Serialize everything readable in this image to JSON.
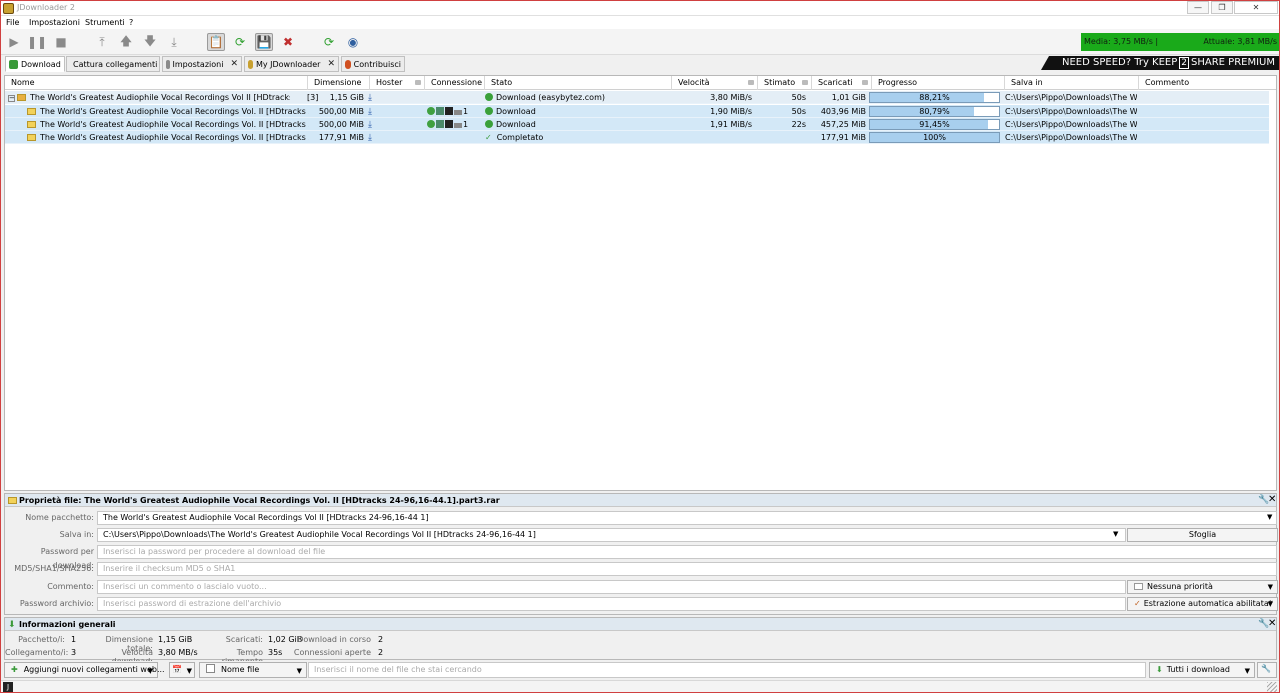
{
  "window": {
    "title": "JDownloader 2",
    "controls": [
      "—",
      "❐",
      "✕"
    ]
  },
  "menu": [
    "File",
    "Impostazioni",
    "Strumenti",
    "?"
  ],
  "speed": {
    "average": "Media: 3,75 MB/s |",
    "current": "Attuale: 3,81 MB/s",
    "color": "#1aaa1a"
  },
  "tabs": [
    {
      "label": "Download",
      "icon": "download-icon",
      "closable": false
    },
    {
      "label": "Cattura collegamenti",
      "icon": "link-grabber-icon",
      "closable": false
    },
    {
      "label": "Impostazioni",
      "icon": "settings-icon",
      "closable": true
    },
    {
      "label": "My JDownloader",
      "icon": "my-jdownloader-icon",
      "closable": true
    },
    {
      "label": "Contribuisci",
      "icon": "heart-icon",
      "closable": false
    }
  ],
  "banner": {
    "pre": "NEED SPEED? Try KEEP",
    "mid": "2",
    "post": "SHARE PREMIUM"
  },
  "columns": [
    "Nome",
    "Dimensione",
    "Hoster",
    "Connessione",
    "Stato",
    "Velocità",
    "Stimato",
    "Scaricati",
    "Progresso",
    "Salva in",
    "Commento"
  ],
  "package": {
    "name": "The World's Greatest Audiophile Vocal Recordings Vol II [HDtracks 24-96...",
    "count": "[3]",
    "size": "1,15 GiB",
    "status": "Download (easybytez.com)",
    "speed": "3,80 MiB/s",
    "eta": "50s",
    "loaded": "1,01 GiB",
    "progress": 88.21,
    "progress_text": "88,21%",
    "path": "C:\\Users\\Pippo\\Downloads\\The Wo..."
  },
  "files": [
    {
      "name": "The World's Greatest Audiophile Vocal Recordings Vol. II [HDtracks 24-96,16...",
      "size": "500,00 MiB",
      "conn": "1",
      "status": "Download",
      "speed": "1,90 MiB/s",
      "eta": "50s",
      "loaded": "403,96 MiB",
      "progress": 80.79,
      "progress_text": "80,79%",
      "path": "C:\\Users\\Pippo\\Downloads\\The Wo..."
    },
    {
      "name": "The World's Greatest Audiophile Vocal Recordings Vol. II [HDtracks 24-96,16...",
      "size": "500,00 MiB",
      "conn": "1",
      "status": "Download",
      "speed": "1,91 MiB/s",
      "eta": "22s",
      "loaded": "457,25 MiB",
      "progress": 91.45,
      "progress_text": "91,45%",
      "path": "C:\\Users\\Pippo\\Downloads\\The Wo..."
    },
    {
      "name": "The World's Greatest Audiophile Vocal Recordings Vol. II [HDtracks 24-96,16...",
      "size": "177,91 MiB",
      "conn": "",
      "status": "Completato",
      "speed": "",
      "eta": "",
      "loaded": "177,91 MiB",
      "progress": 100,
      "progress_text": "100%",
      "path": "C:\\Users\\Pippo\\Downloads\\The Wo..."
    }
  ],
  "props": {
    "title": "Proprietà file: The World's Greatest Audiophile Vocal Recordings Vol. II [HDtracks 24-96,16-44.1].part3.rar",
    "package_label": "Nome pacchetto:",
    "package_value": "The World's Greatest Audiophile Vocal Recordings Vol II [HDtracks 24-96,16-44 1]",
    "save_label": "Salva in:",
    "save_value": "C:\\Users\\Pippo\\Downloads\\The World's Greatest Audiophile Vocal Recordings Vol II [HDtracks 24-96,16-44 1]",
    "browse": "Sfoglia",
    "pwd_label": "Password per download:",
    "pwd_ph": "Inserisci la password per procedere al download del file",
    "hash_label": "MD5/SHA1/SHA256:",
    "hash_ph": "Inserire il checksum MD5 o SHA1",
    "comment_label": "Commento:",
    "comment_ph": "Inserisci un commento o lascialo vuoto...",
    "priority": "Nessuna priorità",
    "archive_label": "Password archivio:",
    "archive_ph": "Inserisci password di estrazione dell'archivio",
    "extract": "Estrazione automatica abilitata*"
  },
  "info": {
    "title": "Informazioni generali",
    "packages_label": "Pacchetto/i:",
    "packages": "1",
    "total_label": "Dimensione totale:",
    "total": "1,15 GiB",
    "loaded_label": "Scaricati:",
    "loaded": "1,02 GiB",
    "running_label": "Download in corso",
    "running": "2",
    "links_label": "Collegamento/i:",
    "links": "3",
    "speed_label": "Velocità download:",
    "speed": "3,80 MB/s",
    "remaining_label": "Tempo rimanente",
    "remaining": "35s",
    "connections_label": "Connessioni aperte",
    "connections": "2"
  },
  "bottom": {
    "add": "Aggiungi nuovi collegamenti web...",
    "filter": "Nome file",
    "search_ph": "Inserisci il nome del file che stai cercando",
    "all": "Tutti i download"
  }
}
